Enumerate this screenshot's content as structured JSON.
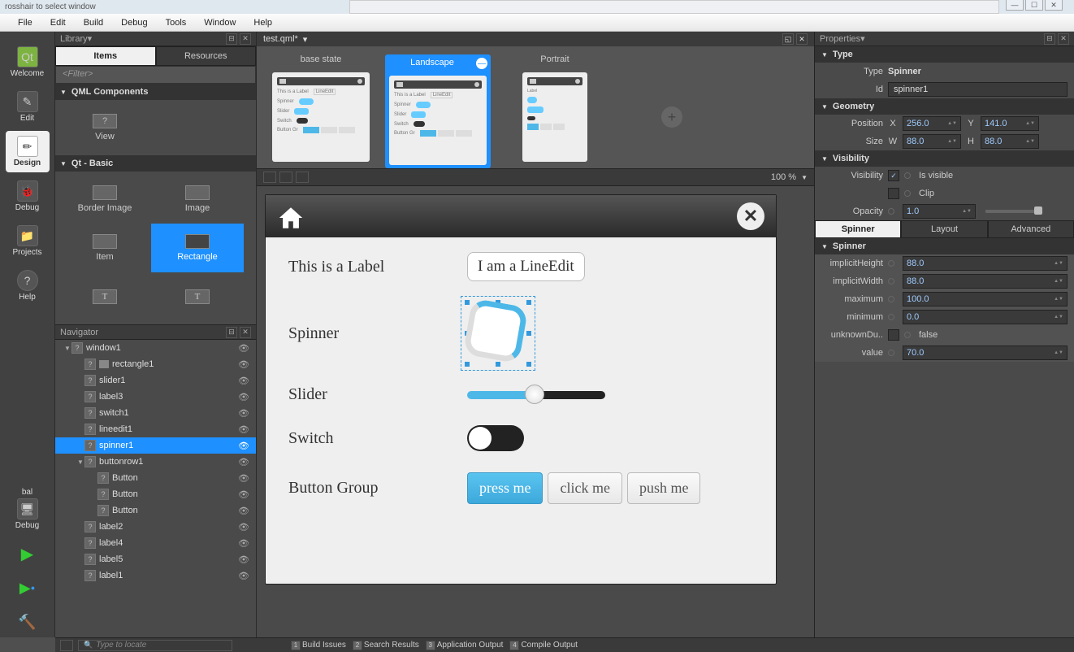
{
  "os_hint": "rosshair to select window",
  "menubar": [
    "File",
    "Edit",
    "Build",
    "Debug",
    "Tools",
    "Window",
    "Help"
  ],
  "iconbar": [
    {
      "label": "Welcome",
      "active": false
    },
    {
      "label": "Edit",
      "active": false
    },
    {
      "label": "Design",
      "active": true
    },
    {
      "label": "Debug",
      "active": false
    },
    {
      "label": "Projects",
      "active": false
    },
    {
      "label": "Help",
      "active": false
    }
  ],
  "iconbar_bottom": [
    {
      "label": "bal"
    },
    {
      "label": "Debug"
    }
  ],
  "library": {
    "title": "Library",
    "tabs": [
      "Items",
      "Resources"
    ],
    "active_tab": "Items",
    "filter_placeholder": "<Filter>",
    "section1": "QML Components",
    "section1_items": [
      {
        "label": "View"
      }
    ],
    "section2": "Qt - Basic",
    "section2_items": [
      {
        "label": "Border Image"
      },
      {
        "label": "Image"
      },
      {
        "label": "Item"
      },
      {
        "label": "Rectangle",
        "sel": true
      },
      {
        "label": "T"
      },
      {
        "label": "T"
      }
    ]
  },
  "navigator": {
    "title": "Navigator",
    "tree": [
      {
        "d": 1,
        "label": "window1",
        "arrow": "▼"
      },
      {
        "d": 2,
        "label": "rectangle1",
        "ico": "r"
      },
      {
        "d": 2,
        "label": "slider1"
      },
      {
        "d": 2,
        "label": "label3"
      },
      {
        "d": 2,
        "label": "switch1"
      },
      {
        "d": 2,
        "label": "lineedit1"
      },
      {
        "d": 2,
        "label": "spinner1",
        "sel": true
      },
      {
        "d": 2,
        "label": "buttonrow1",
        "arrow": "▼"
      },
      {
        "d": 3,
        "label": "Button"
      },
      {
        "d": 3,
        "label": "Button"
      },
      {
        "d": 3,
        "label": "Button"
      },
      {
        "d": 2,
        "label": "label2"
      },
      {
        "d": 2,
        "label": "label4"
      },
      {
        "d": 2,
        "label": "label5"
      },
      {
        "d": 2,
        "label": "label1"
      }
    ]
  },
  "document": {
    "name": "test.qml*"
  },
  "states": [
    {
      "name": "base state"
    },
    {
      "name": "Landscape",
      "sel": true
    },
    {
      "name": "Portrait"
    }
  ],
  "zoom": "100 %",
  "canvas": {
    "label_text": "This is a Label",
    "lineedit_text": "I am a LineEdit",
    "spinner_label": "Spinner",
    "slider_label": "Slider",
    "switch_label": "Switch",
    "group_label": "Button Group",
    "buttons": [
      "press me",
      "click me",
      "push me"
    ]
  },
  "properties": {
    "title": "Properties",
    "type_section": "Type",
    "type_label": "Type",
    "type_value": "Spinner",
    "id_label": "Id",
    "id_value": "spinner1",
    "geom_section": "Geometry",
    "pos_label": "Position",
    "x_label": "X",
    "x_value": "256.0",
    "y_label": "Y",
    "y_value": "141.0",
    "size_label": "Size",
    "w_label": "W",
    "w_value": "88.0",
    "h_label": "H",
    "h_value": "88.0",
    "vis_section": "Visibility",
    "vis_label": "Visibility",
    "isvisible": "Is visible",
    "clip": "Clip",
    "opacity_label": "Opacity",
    "opacity_value": "1.0",
    "subtabs": [
      "Spinner",
      "Layout",
      "Advanced"
    ],
    "subtab_active": "Spinner",
    "spinner_section": "Spinner",
    "rows": [
      {
        "label": "implicitHeight",
        "value": "88.0"
      },
      {
        "label": "implicitWidth",
        "value": "88.0"
      },
      {
        "label": "maximum",
        "value": "100.0"
      },
      {
        "label": "minimum",
        "value": "0.0"
      },
      {
        "label": "unknownDu..",
        "value": "false",
        "chk": true
      },
      {
        "label": "value",
        "value": "70.0"
      }
    ]
  },
  "bottom": {
    "locate": "Type to locate",
    "panes": [
      {
        "n": "1",
        "t": "Build Issues"
      },
      {
        "n": "2",
        "t": "Search Results"
      },
      {
        "n": "3",
        "t": "Application Output"
      },
      {
        "n": "4",
        "t": "Compile Output"
      }
    ]
  }
}
